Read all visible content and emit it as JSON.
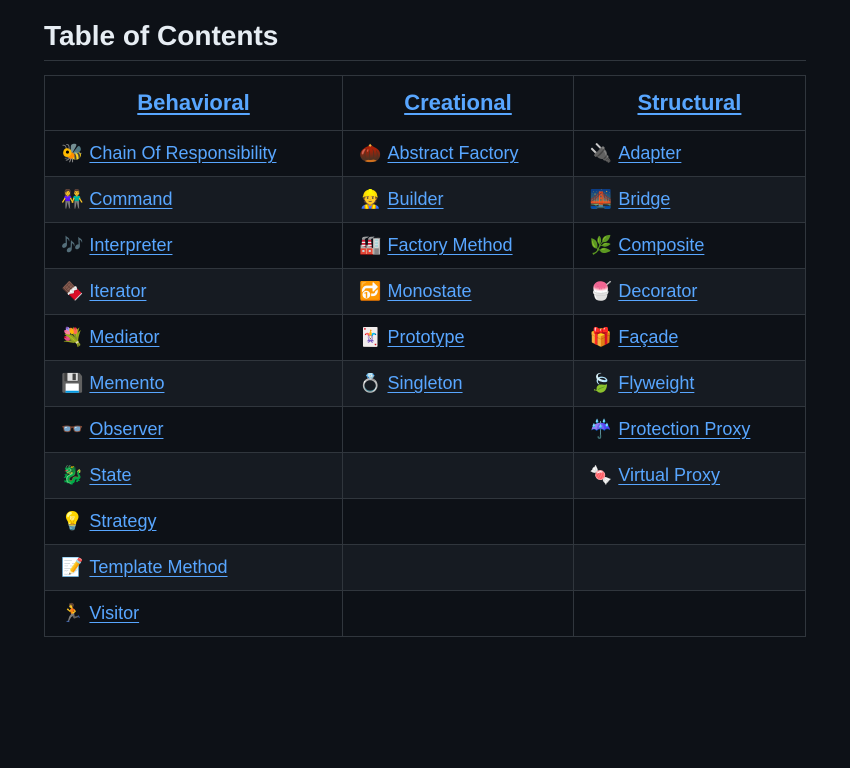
{
  "title": "Table of Contents",
  "columns": [
    {
      "label": "Behavioral"
    },
    {
      "label": "Creational"
    },
    {
      "label": "Structural"
    }
  ],
  "rows": [
    {
      "behavioral": {
        "icon": "🐝",
        "label": "Chain Of Responsibility"
      },
      "creational": {
        "icon": "🌰",
        "label": "Abstract Factory"
      },
      "structural": {
        "icon": "🔌",
        "label": "Adapter"
      }
    },
    {
      "behavioral": {
        "icon": "👫",
        "label": "Command"
      },
      "creational": {
        "icon": "👷",
        "label": "Builder"
      },
      "structural": {
        "icon": "🌉",
        "label": "Bridge"
      }
    },
    {
      "behavioral": {
        "icon": "🎶",
        "label": "Interpreter"
      },
      "creational": {
        "icon": "🏭",
        "label": "Factory Method"
      },
      "structural": {
        "icon": "🌿",
        "label": "Composite"
      }
    },
    {
      "behavioral": {
        "icon": "🍫",
        "label": "Iterator"
      },
      "creational": {
        "icon": "🔂",
        "label": "Monostate"
      },
      "structural": {
        "icon": "🍧",
        "label": "Decorator"
      }
    },
    {
      "behavioral": {
        "icon": "💐",
        "label": "Mediator"
      },
      "creational": {
        "icon": "🃏",
        "label": "Prototype"
      },
      "structural": {
        "icon": "🎁",
        "label": "Façade"
      }
    },
    {
      "behavioral": {
        "icon": "💾",
        "label": "Memento"
      },
      "creational": {
        "icon": "💍",
        "label": "Singleton"
      },
      "structural": {
        "icon": "🍃",
        "label": "Flyweight"
      }
    },
    {
      "behavioral": {
        "icon": "👓",
        "label": "Observer"
      },
      "creational": null,
      "structural": {
        "icon": "☔",
        "label": "Protection Proxy"
      }
    },
    {
      "behavioral": {
        "icon": "🐉",
        "label": "State"
      },
      "creational": null,
      "structural": {
        "icon": "🍬",
        "label": "Virtual Proxy"
      }
    },
    {
      "behavioral": {
        "icon": "💡",
        "label": "Strategy"
      },
      "creational": null,
      "structural": null
    },
    {
      "behavioral": {
        "icon": "📝",
        "label": "Template Method"
      },
      "creational": null,
      "structural": null
    },
    {
      "behavioral": {
        "icon": "🏃",
        "label": "Visitor"
      },
      "creational": null,
      "structural": null
    }
  ]
}
